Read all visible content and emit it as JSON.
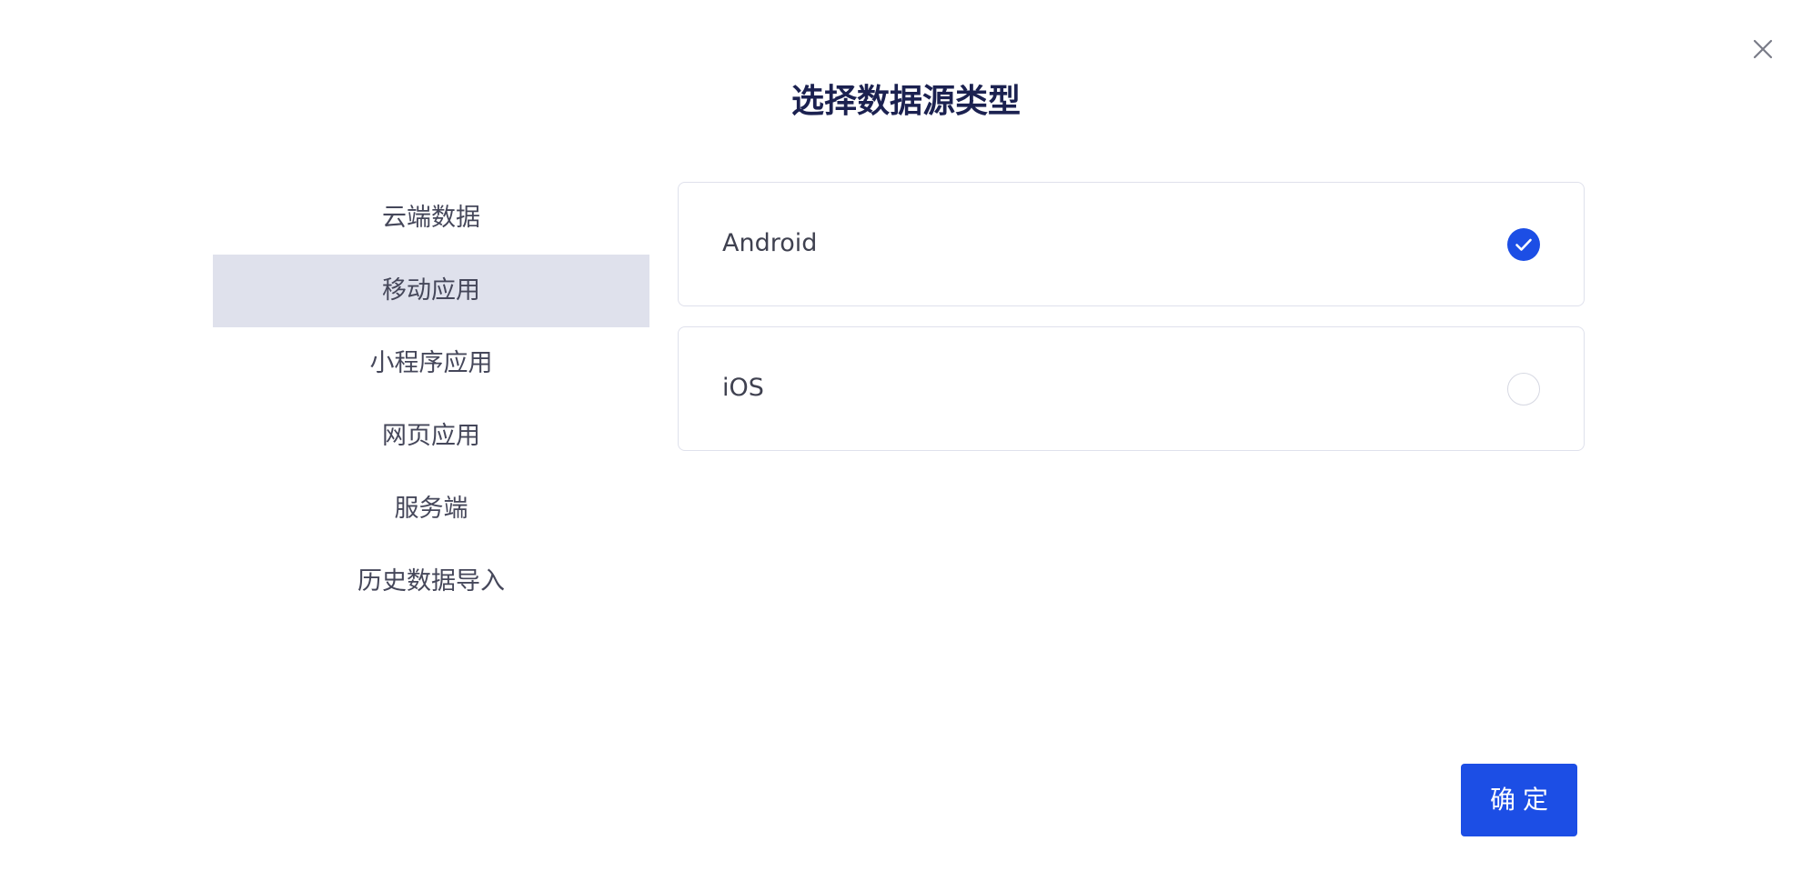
{
  "dialog": {
    "title": "选择数据源类型",
    "confirm_label": "确定"
  },
  "categories": [
    {
      "label": "云端数据",
      "active": false
    },
    {
      "label": "移动应用",
      "active": true
    },
    {
      "label": "小程序应用",
      "active": false
    },
    {
      "label": "网页应用",
      "active": false
    },
    {
      "label": "服务端",
      "active": false
    },
    {
      "label": "历史数据导入",
      "active": false
    }
  ],
  "options": [
    {
      "label": "Android",
      "selected": true
    },
    {
      "label": "iOS",
      "selected": false
    }
  ],
  "colors": {
    "accent": "#1c4ee5",
    "title": "#1b2150",
    "active_bg": "#dfe1ec",
    "text": "#45475a",
    "border": "#dfe1ec"
  },
  "icons": {
    "close": "close-icon",
    "check": "checkmark-icon"
  }
}
